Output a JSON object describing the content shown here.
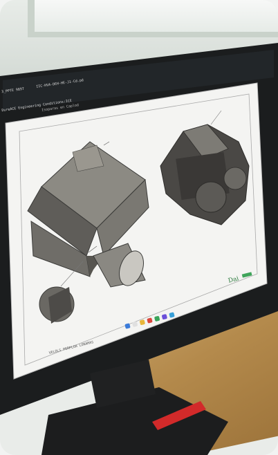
{
  "scene": {
    "description_tags": [
      "monitor-photo",
      "cad-drawing"
    ]
  },
  "screen": {
    "tab1_label": "3_PPTE 9897",
    "tab2_label": "IIC-HVA-DEH-HE-J1-Cd.pd",
    "toolbar_text": "DureACE Engineering Conditions:ICE",
    "subtitle_text": "Isoparas en Caplod",
    "title_block_text": "VELOLS PERPLOA LONAMAS",
    "brand_text": "Dai"
  },
  "colors": {
    "frame": "#1a1c1d",
    "sheet": "#f6f6f4",
    "part_fill": "#6f6d68",
    "accent": "#d22a2a",
    "brand": "#2a7a3c"
  }
}
